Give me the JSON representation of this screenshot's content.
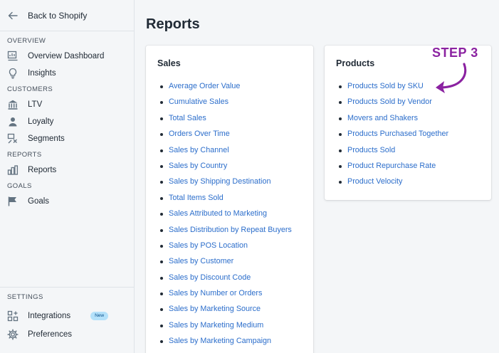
{
  "sidebar": {
    "back_label": "Back to Shopify",
    "sections": {
      "overview": "OVERVIEW",
      "customers": "CUSTOMERS",
      "reports": "REPORTS",
      "goals": "GOALS",
      "settings": "SETTINGS"
    },
    "items": {
      "overview_dashboard": "Overview Dashboard",
      "insights": "Insights",
      "ltv": "LTV",
      "loyalty": "Loyalty",
      "segments": "Segments",
      "reports": "Reports",
      "goals": "Goals",
      "integrations": "Integrations",
      "preferences": "Preferences"
    },
    "integrations_badge": "New"
  },
  "main": {
    "title": "Reports",
    "sales": {
      "title": "Sales",
      "links": [
        "Average Order Value",
        "Cumulative Sales",
        "Total Sales",
        "Orders Over Time",
        "Sales by Channel",
        "Sales by Country",
        "Sales by Shipping Destination",
        "Total Items Sold",
        "Sales Attributed to Marketing",
        "Sales Distribution by Repeat Buyers",
        "Sales by POS Location",
        "Sales by Customer",
        "Sales by Discount Code",
        "Sales by Number or Orders",
        "Sales by Marketing Source",
        "Sales by Marketing Medium",
        "Sales by Marketing Campaign"
      ]
    },
    "products": {
      "title": "Products",
      "links": [
        "Products Sold by SKU",
        "Products Sold by Vendor",
        "Movers and Shakers",
        "Products Purchased Together",
        "Products Sold",
        "Product Repurchase Rate",
        "Product Velocity"
      ]
    }
  },
  "annotation": {
    "label": "STEP 3",
    "color": "#8b22a1"
  },
  "colors": {
    "link": "#2c6ecb",
    "sidebar_bg": "#f4f6f8",
    "card_bg": "#ffffff",
    "badge_bg": "#b4e1fa"
  }
}
